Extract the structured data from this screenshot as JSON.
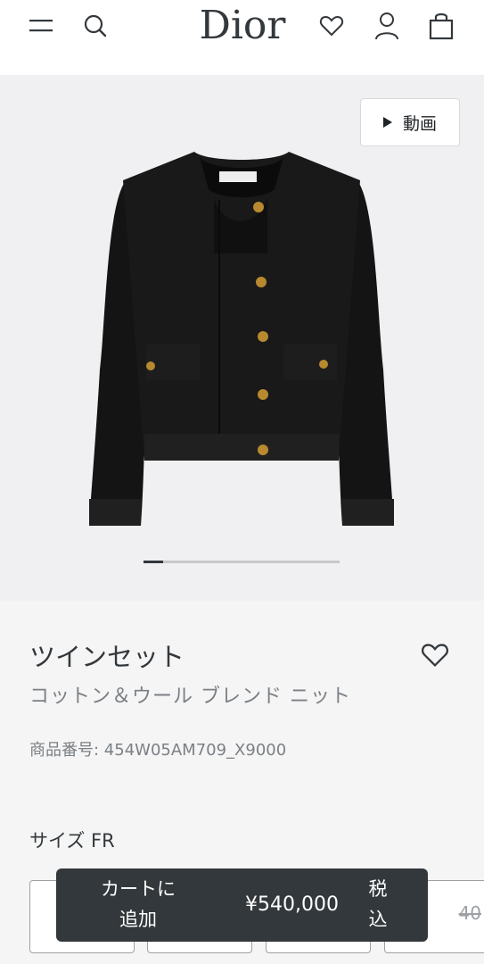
{
  "header": {
    "logo": "Dior",
    "icons": [
      "menu-icon",
      "search-icon",
      "heart-icon",
      "user-icon",
      "shopping-bag-icon"
    ]
  },
  "hero": {
    "video_label": "動画",
    "progress": 0.1
  },
  "product": {
    "title": "ツインセット",
    "subtitle": "コットン＆ウール ブレンド ニット",
    "sku": "商品番号: 454W05AM709_X9000"
  },
  "size": {
    "label": "サイズ FR",
    "struck_partial": "40"
  },
  "cart": {
    "label_line1": "カートに",
    "label_line2": "追加",
    "price": "¥540,000",
    "tax_line1": "税",
    "tax_line2": "込"
  },
  "colors": {
    "dark": "#33383c",
    "hero_bg": "#f0f0f2",
    "page_bg": "#f5f5f5",
    "accent_gold": "#b8892f"
  }
}
